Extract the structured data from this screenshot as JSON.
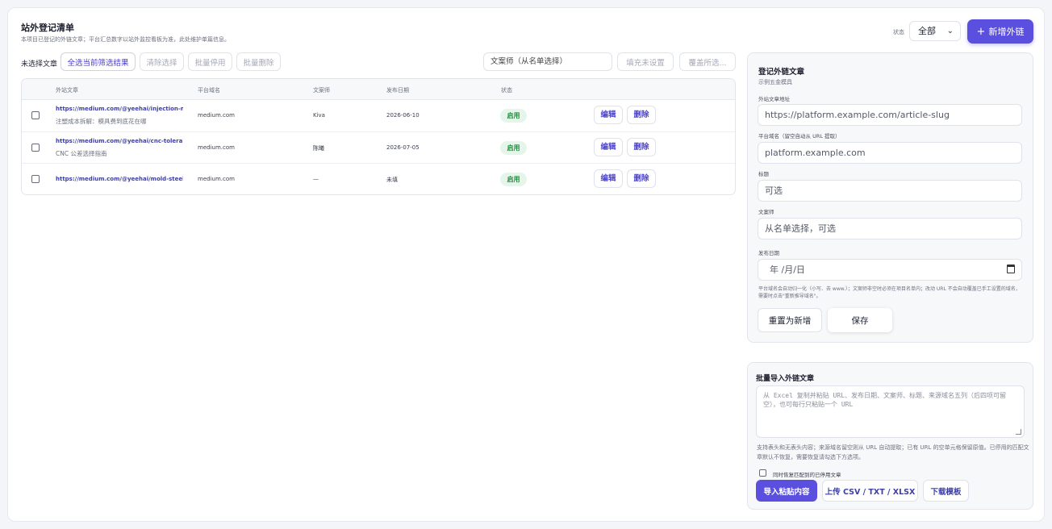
{
  "header": {
    "title": "站外登记清单",
    "subtitle": "本项目已登记的外链文章；平台汇总数字以站外监控看板为准，此处维护单篇信息。",
    "status_label": "状态",
    "status_value": "全部",
    "add_button": "新增外链"
  },
  "toolbar": {
    "selection_label": "未选择文章",
    "select_all": "全选当前筛选结果",
    "clear": "清除选择",
    "bulk_disable": "批量停用",
    "bulk_delete": "批量删除",
    "copywriter_select": "文案师（从名单选择）",
    "fill_unset": "填充未设置",
    "overwrite": "覆盖所选..."
  },
  "table": {
    "headers": [
      "外站文章",
      "平台域名",
      "文案师",
      "发布日期",
      "状态"
    ],
    "rows": [
      {
        "url": "https://medium.com/@yeehai/injection-mo...",
        "title": "注塑成本拆解：模具费到底花在哪",
        "domain": "medium.com",
        "copywriter": "Kiva",
        "date": "2026-06-10",
        "status": "启用",
        "edit": "编辑",
        "delete": "删除"
      },
      {
        "url": "https://medium.com/@yeehai/cnc-toleranc...",
        "title": "CNC 公差选择指南",
        "domain": "medium.com",
        "copywriter": "陈曦",
        "date": "2026-07-05",
        "status": "启用",
        "edit": "编辑",
        "delete": "删除"
      },
      {
        "url": "https://medium.com/@yeehai/mold-steel-c...",
        "title": "",
        "domain": "medium.com",
        "copywriter": "—",
        "date": "未填",
        "status": "启用",
        "edit": "编辑",
        "delete": "删除"
      }
    ]
  },
  "form": {
    "title": "登记外链文章",
    "subtitle": "示例五金模具",
    "url_label": "外站文章地址",
    "url_placeholder": "https://platform.example.com/article-slug",
    "domain_label": "平台域名（留空自动从 URL 提取）",
    "domain_placeholder": "platform.example.com",
    "title_label": "标题",
    "title_placeholder": "可选",
    "copywriter_label": "文案师",
    "copywriter_placeholder": "从名单选择，可选",
    "date_label": "发布日期",
    "date_placeholder": "年 /月/日",
    "hint": "平台域名会自动归一化（小写、去 www.）；文案师非空时必须在项目名单内；改动 URL 不会自动覆盖已手工设置的域名，需要时点击\"重新推导域名\"。",
    "reset_button": "重置为新增",
    "save_button": "保存"
  },
  "import": {
    "title": "批量导入外链文章",
    "textarea_placeholder": "从 Excel 复制并粘贴 URL、发布日期、文案师、标题、来源域名五列（后四项可留空），也可每行只粘贴一个 URL",
    "hint": "支持表头和无表头内容；来源域名留空则从 URL 自动提取；已有 URL 的空单元格保留原值。已停用的匹配文章默认不恢复，需要恢复请勾选下方选项。",
    "restore_label": "同时恢复匹配到的已停用文章",
    "import_button": "导入粘贴内容",
    "upload_button": "上传 CSV / TXT / XLSX",
    "template_button": "下载模板"
  }
}
